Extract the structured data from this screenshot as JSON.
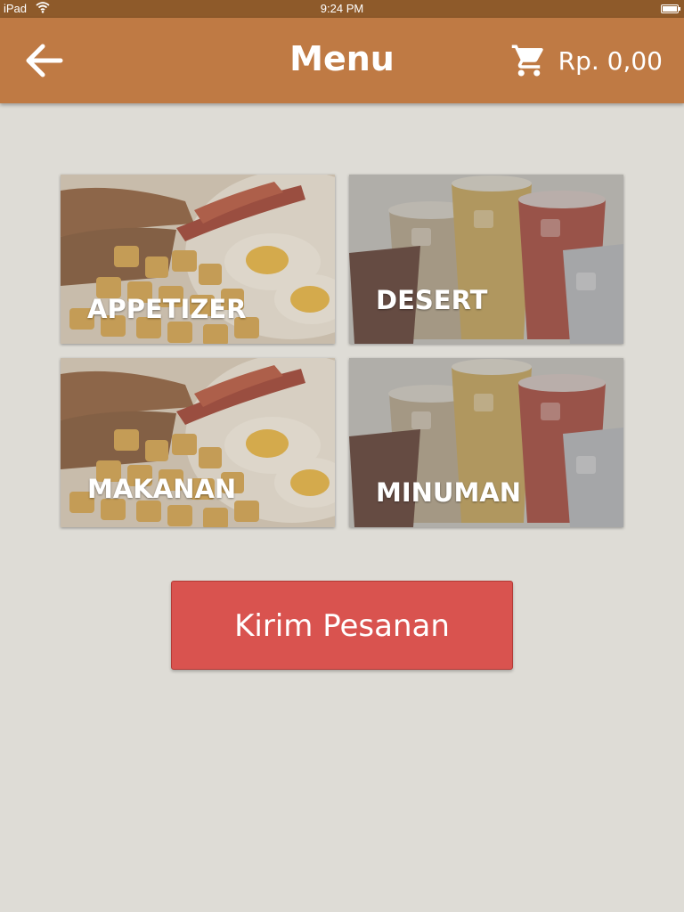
{
  "status_bar": {
    "carrier": "iPad",
    "time": "9:24 PM"
  },
  "app_bar": {
    "title": "Menu",
    "cart_total": "Rp. 0,00",
    "icons": {
      "back": "arrow-left-icon",
      "cart": "shopping-cart-icon"
    }
  },
  "categories": [
    {
      "label": "APPETIZER",
      "image": "breakfast-plate"
    },
    {
      "label": "DESERT",
      "image": "drink-glasses"
    },
    {
      "label": "MAKANAN",
      "image": "breakfast-plate"
    },
    {
      "label": "MINUMAN",
      "image": "drink-glasses"
    }
  ],
  "submit_button": {
    "label": "Kirim Pesanan"
  },
  "colors": {
    "app_bar": "#bf7a44",
    "status_bar": "#8e5a2a",
    "background": "#dedcd6",
    "submit_button": "#d9534f"
  }
}
